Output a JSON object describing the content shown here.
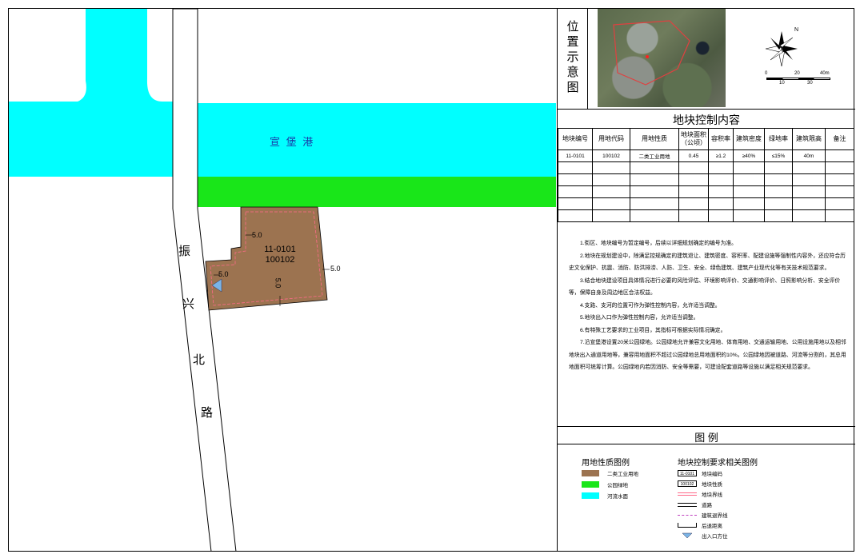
{
  "map": {
    "river_name": "宣 堡 港",
    "road_name": [
      "振",
      "兴",
      "北",
      "路"
    ],
    "parcel": {
      "code": "11-0101",
      "land_code": "100102"
    },
    "setbacks": [
      "5.0",
      "5.0",
      "5.0",
      "5.0"
    ]
  },
  "location": {
    "title": [
      "位",
      "置",
      "示",
      "意",
      "图"
    ],
    "scale": {
      "ticks_top": [
        "0",
        "20",
        "40m"
      ],
      "ticks_bottom": [
        "10",
        "30"
      ]
    },
    "north_label": "N"
  },
  "control": {
    "title": "地块控制内容",
    "headers": [
      "地块编号",
      "用地代码",
      "用地性质",
      "地块面积\n（公顷）",
      "容积率",
      "建筑密度",
      "绿地率",
      "建筑限高",
      "备注"
    ],
    "rows": [
      [
        "11-0101",
        "100102",
        "二类工业用地",
        "0.45",
        "≥1.2",
        "≥40%",
        "≤15%",
        "40m",
        ""
      ],
      [
        "",
        "",
        "",
        "",
        "",
        "",
        "",
        "",
        ""
      ],
      [
        "",
        "",
        "",
        "",
        "",
        "",
        "",
        "",
        ""
      ],
      [
        "",
        "",
        "",
        "",
        "",
        "",
        "",
        "",
        ""
      ],
      [
        "",
        "",
        "",
        "",
        "",
        "",
        "",
        "",
        ""
      ],
      [
        "",
        "",
        "",
        "",
        "",
        "",
        "",
        "",
        ""
      ]
    ]
  },
  "notes": [
    "1.街区、地块编号为暂定编号，后续以详细规划确定的编号为准。",
    "2.地块在规划建设中，除满足控规确定的建筑退让、建筑密度、容积率、配建设施等强制性内容外，还应符合历史文化保护、抗震、消防、防洪排涝、人防、卫生、安全、绿色建筑、建筑产业现代化等有关技术规范要求。",
    "3.结合地块建设项目具体情况进行必要的风险评估、环境影响评价、交通影响评价、日照影响分析、安全评价等，保障自身及周边地区合法权益。",
    "4.支路、支河的位置可作为弹性控制内容，允许适当调整。",
    "5.地块出入口作为弹性控制内容，允许适当调整。",
    "6.有特殊工艺要求的工业项目，其指标可根据实际情况确定。",
    "7.沿宣堡港设置20米公园绿地。公园绿地允许兼容文化用地、体育用地、交通运输用地、公用设施用地以及相邻地块出入通道用地等，兼容用地面积不超过公园绿地总用地面积的10%。公园绿地因被道路、河流等分割的，其总用地面积可统筹计算。公园绿地内若因消防、安全等需要，可建设配套道路等设施以满足相关规范要求。"
  ],
  "legend": {
    "title": "图  例",
    "landuse_title": "用地性质图例",
    "landuse": [
      {
        "label": "二类工业用地",
        "color": "#9c7350"
      },
      {
        "label": "公园绿地",
        "color": "#19e619"
      },
      {
        "label": "河流水面",
        "color": "#00ffff"
      }
    ],
    "control_title": "地块控制要求相关图例",
    "control": [
      {
        "sym": "11-0101",
        "label": "地块编码"
      },
      {
        "sym": "100102",
        "label": "地块性质"
      },
      {
        "sym": "",
        "label": "地块界线"
      },
      {
        "sym": "",
        "label": "道路"
      },
      {
        "sym": "",
        "label": "建筑退界线"
      },
      {
        "sym": "",
        "label": "后退距离"
      },
      {
        "sym": "",
        "label": "出入口方位"
      }
    ]
  },
  "colors": {
    "water": "#00ffff",
    "green": "#19e619",
    "industrial": "#9c7350",
    "boundary": "#ff6a8a"
  }
}
